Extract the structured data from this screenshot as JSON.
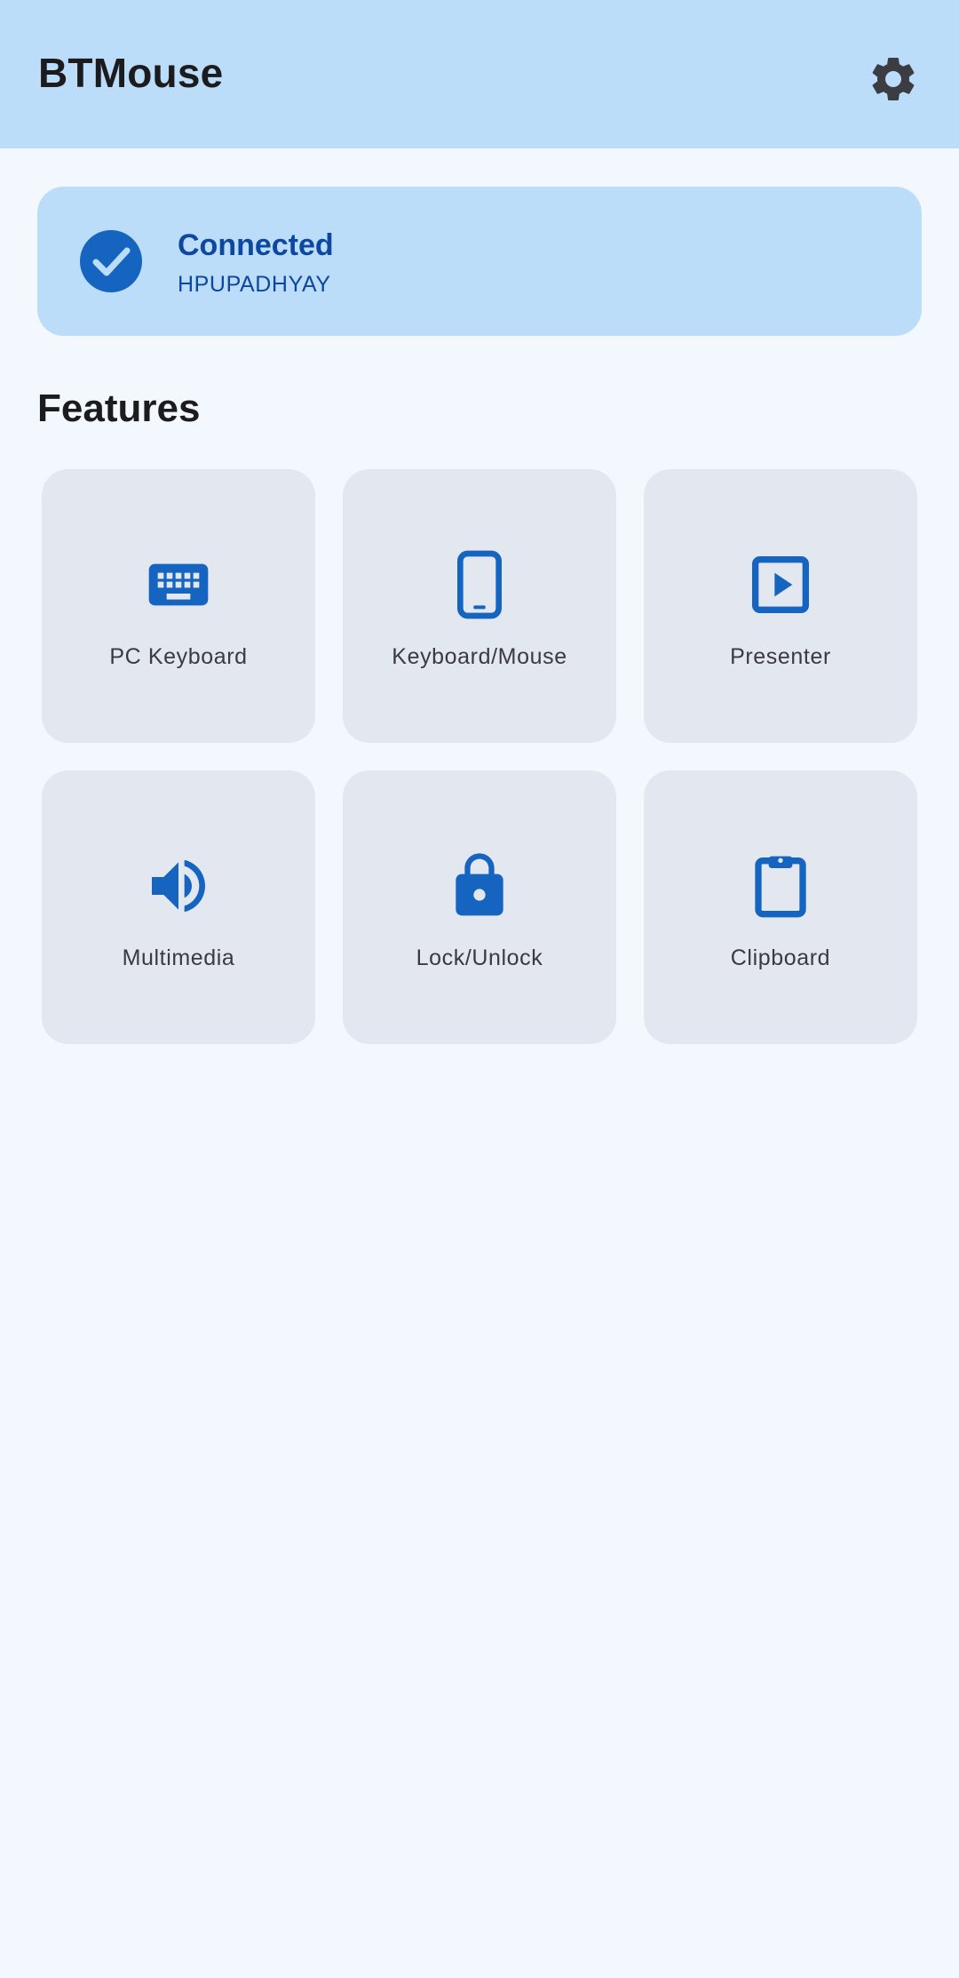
{
  "app_bar": {
    "title": "BTMouse",
    "settings_icon": "gear-icon"
  },
  "status": {
    "icon": "check-circle-icon",
    "title": "Connected",
    "device_name": "HPUPADHYAY"
  },
  "features": {
    "title": "Features",
    "items": [
      {
        "label": "PC Keyboard",
        "icon": "keyboard-icon"
      },
      {
        "label": "Keyboard/Mouse",
        "icon": "smartphone-icon"
      },
      {
        "label": "Presenter",
        "icon": "slideshow-play-icon"
      },
      {
        "label": "Multimedia",
        "icon": "volume-icon"
      },
      {
        "label": "Lock/Unlock",
        "icon": "lock-icon"
      },
      {
        "label": "Clipboard",
        "icon": "clipboard-icon"
      }
    ]
  },
  "colors": {
    "app_bar_bg": "#BBDDF9",
    "page_bg": "#F3F7FE",
    "tile_bg": "#E3E7F0",
    "accent_blue": "#1565C0",
    "status_text": "#0D47A1",
    "icon_dark": "#3C3C43"
  }
}
